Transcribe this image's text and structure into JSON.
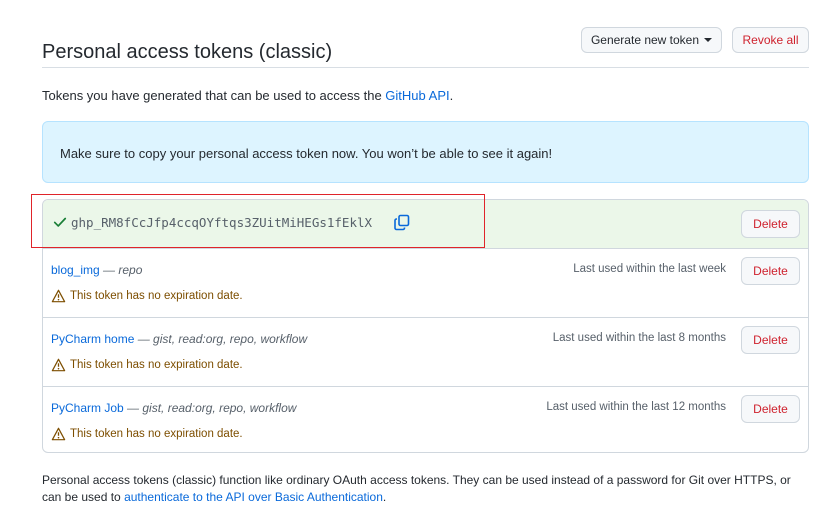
{
  "header": {
    "title": "Personal access tokens (classic)",
    "generate_label": "Generate new token",
    "revoke_label": "Revoke all"
  },
  "intro": {
    "text": "Tokens you have generated that can be used to access the ",
    "link": "GitHub API",
    "end": "."
  },
  "flash": {
    "message": "Make sure to copy your personal access token now. You won’t be able to see it again!"
  },
  "new_token": {
    "value": "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",
    "delete_label": "Delete"
  },
  "tokens": [
    {
      "name": "blog_img",
      "scopes": "repo",
      "last_used": "Last used within the last week",
      "warning": "This token has no expiration date.",
      "delete_label": "Delete"
    },
    {
      "name": "PyCharm home",
      "scopes": "gist, read:org, repo, workflow",
      "last_used": "Last used within the last 8 months",
      "warning": "This token has no expiration date.",
      "delete_label": "Delete"
    },
    {
      "name": "PyCharm Job",
      "scopes": "gist, read:org, repo, workflow",
      "last_used": "Last used within the last 12 months",
      "warning": "This token has no expiration date.",
      "delete_label": "Delete"
    }
  ],
  "footer": {
    "text": "Personal access tokens (classic) function like ordinary OAuth access tokens. They can be used instead of a password for Git over HTTPS, or can be used to ",
    "link": "authenticate to the API over Basic Authentication",
    "end": "."
  },
  "colors": {
    "accent": "#0969da",
    "danger": "#cf222e",
    "success_bg": "#ebf7e9",
    "info_bg": "#ddf4ff",
    "warning": "#7d4e00",
    "highlight": "#e0242a"
  },
  "icons": {
    "check": "check-icon",
    "copy": "copy-icon",
    "warning": "alert-icon",
    "dropdown": "triangle-down-icon"
  }
}
